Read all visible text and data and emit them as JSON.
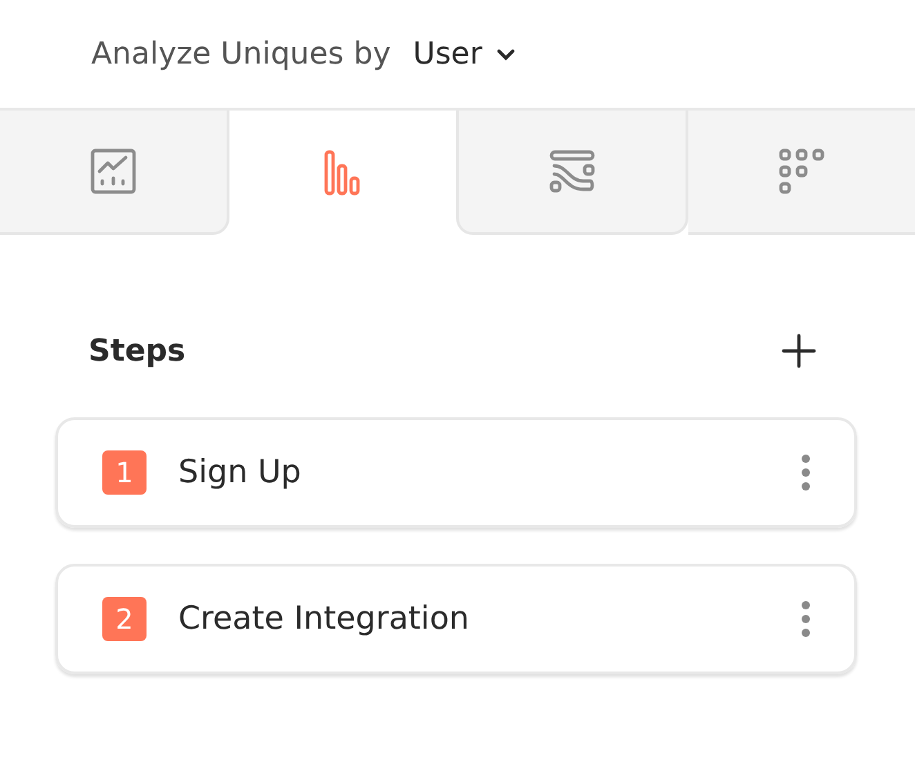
{
  "header": {
    "label": "Analyze Uniques by",
    "value": "User"
  },
  "tabs": [
    {
      "kind": "trend",
      "selected": false
    },
    {
      "kind": "bars",
      "selected": true
    },
    {
      "kind": "flow",
      "selected": false
    },
    {
      "kind": "grid",
      "selected": false
    }
  ],
  "steps": {
    "title": "Steps",
    "items": [
      {
        "number": "1",
        "name": "Sign Up"
      },
      {
        "number": "2",
        "name": "Create Integration"
      }
    ]
  }
}
